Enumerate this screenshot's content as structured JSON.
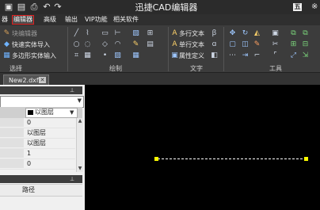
{
  "app": {
    "title": "迅捷CAD编辑器",
    "quick_access": [
      "save-icon",
      "save-as-icon",
      "print-icon",
      "undo-icon",
      "redo-icon"
    ],
    "avatar_glyph": "五",
    "right_glyph": "※"
  },
  "menu": {
    "items": [
      "器",
      "编辑器",
      "高级",
      "输出",
      "VIP功能",
      "相关软件"
    ],
    "active": "编辑器"
  },
  "ribbon": {
    "select_group": {
      "label": "选择",
      "items": [
        "块编辑器",
        "快速实体导入",
        "多边形实体输入"
      ]
    },
    "draw_group": {
      "label": "绘制"
    },
    "text_group": {
      "label": "文字",
      "items": [
        "多行文本",
        "单行文本",
        "属性定义"
      ]
    },
    "tools_group": {
      "label": "工具"
    }
  },
  "document_tab": {
    "label": "New2.dxf",
    "close_glyph": "✕"
  },
  "properties_panel": {
    "pin_glyph": "⊥",
    "layer_value": "以图层",
    "rows": [
      "0",
      "以图层",
      "以图层",
      "1",
      "0"
    ]
  },
  "bottom_panel": {
    "path_header": "路径"
  },
  "colors": {
    "canvas": "#000000",
    "grip": "#ffff00",
    "highlight": "#e02020",
    "ribbon": "#3c3c3c"
  }
}
